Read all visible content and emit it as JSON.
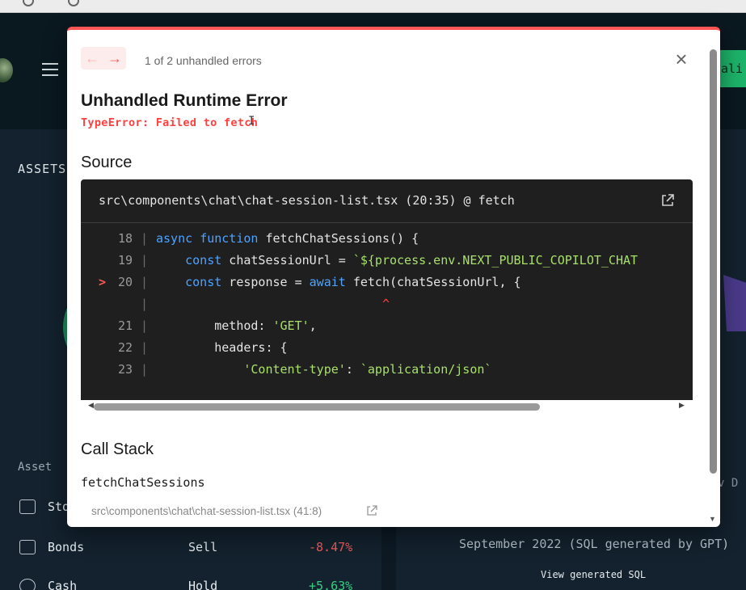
{
  "app": {
    "header_cta": "ali",
    "assets_title": "ASSETS",
    "table": {
      "col_asset": "Asset",
      "rows": [
        {
          "name": "Sto",
          "action": "",
          "change": "",
          "icon": "chart-bar-icon"
        },
        {
          "name": "Bonds",
          "action": "Sell",
          "change": "-8.47%",
          "icon": "bond-icon"
        },
        {
          "name": "Cash",
          "action": "Hold",
          "change": "+5.63%",
          "icon": "dollar-icon"
        }
      ]
    },
    "right_caption": "September 2022 (SQL generated by GPT)",
    "right_link": "View generated SQL",
    "right_tail": "v D"
  },
  "overlay": {
    "error_count": "1 of 2 unhandled errors",
    "title": "Unhandled Runtime Error",
    "message": "TypeError: Failed to fetch",
    "source_heading": "Source",
    "source_path": "src\\components\\chat\\chat-session-list.tsx (20:35) @ fetch",
    "code_lines": [
      {
        "no": "18",
        "code": "async function fetchChatSessions() {"
      },
      {
        "no": "19",
        "code": "    const chatSessionUrl = `${process.env.NEXT_PUBLIC_COPILOT_CHAT"
      },
      {
        "no": "20",
        "code": "    const response = await fetch(chatSessionUrl, {",
        "marker": ">"
      },
      {
        "no": "",
        "code": "                               ^"
      },
      {
        "no": "21",
        "code": "        method: 'GET',"
      },
      {
        "no": "22",
        "code": "        headers: {"
      },
      {
        "no": "23",
        "code": "            'Content-type': `application/json`"
      }
    ],
    "call_stack_heading": "Call Stack",
    "stack_fn": "fetchChatSessions",
    "stack_location": "src\\components\\chat\\chat-session-list.tsx (41:8)"
  },
  "colors": {
    "error_accent": "#ff5555",
    "code_bg": "#1f1f1f",
    "keyword": "#4da3ff",
    "string": "#a8e06a",
    "positive": "#35d07f",
    "negative": "#f15b5b"
  }
}
